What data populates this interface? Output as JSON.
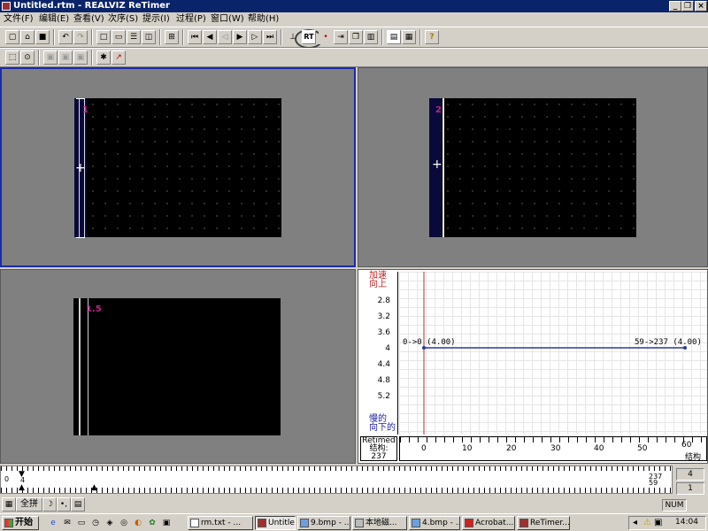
{
  "window": {
    "title": "Untitled.rtm - REALVIZ ReTimer"
  },
  "menu": [
    "文件(F)",
    "编辑(E)",
    "查看(V)",
    "次序(S)",
    "提示(I)",
    "过程(P)",
    "窗口(W)",
    "帮助(H)"
  ],
  "toolbar": {
    "rt_label": "RT"
  },
  "viewports": {
    "frame_a": "1",
    "frame_b": "2",
    "frame_c": "1.5"
  },
  "graph": {
    "y_top_label_1": "加速",
    "y_top_label_2": "向上",
    "y_ticks": [
      "2.8",
      "3.2",
      "3.6",
      "4",
      "4.4",
      "4.8",
      "5.2"
    ],
    "y_bottom_label_1": "慢的",
    "y_bottom_label_2": "向下的",
    "x_ticks": [
      "0",
      "10",
      "20",
      "30",
      "40",
      "50",
      "60"
    ],
    "x_unit": "结构",
    "start_annotation": "0->0  (4.00)",
    "end_annotation": "59->237  (4.00)",
    "retimed_label": "Retimed",
    "retimed_struct": "结构:",
    "retimed_value": "237"
  },
  "timeline": {
    "start_frame": "0",
    "cursor_frame": "4",
    "end_top": "237",
    "end_bottom": "59",
    "field_top": "4",
    "field_bottom": "1"
  },
  "bottom_tabs": {
    "tile_label": "全拼"
  },
  "taskbar": {
    "start": "开始",
    "tasks": [
      "rm.txt - ...",
      "Untitled...",
      "9.bmp - ...",
      "本地磁...",
      "4.bmp - ...",
      "Acrobat...",
      "ReTimer..."
    ],
    "status_num": "NUM",
    "clock": "14:04"
  },
  "colors": {
    "titlebar": "#0a246a",
    "active_border": "#1a2aa8",
    "frame_label": "#c0208a",
    "curve": "#2a3a9a",
    "cursor_line": "#b03030"
  },
  "chart_data": {
    "type": "line",
    "title": "",
    "xlabel": "结构",
    "ylabel": "",
    "xlim": [
      0,
      60
    ],
    "y_ticks": [
      2.8,
      3.2,
      3.6,
      4,
      4.4,
      4.8,
      5.2
    ],
    "series": [
      {
        "x": [
          0,
          59
        ],
        "values": [
          4.0,
          4.0
        ]
      }
    ]
  }
}
